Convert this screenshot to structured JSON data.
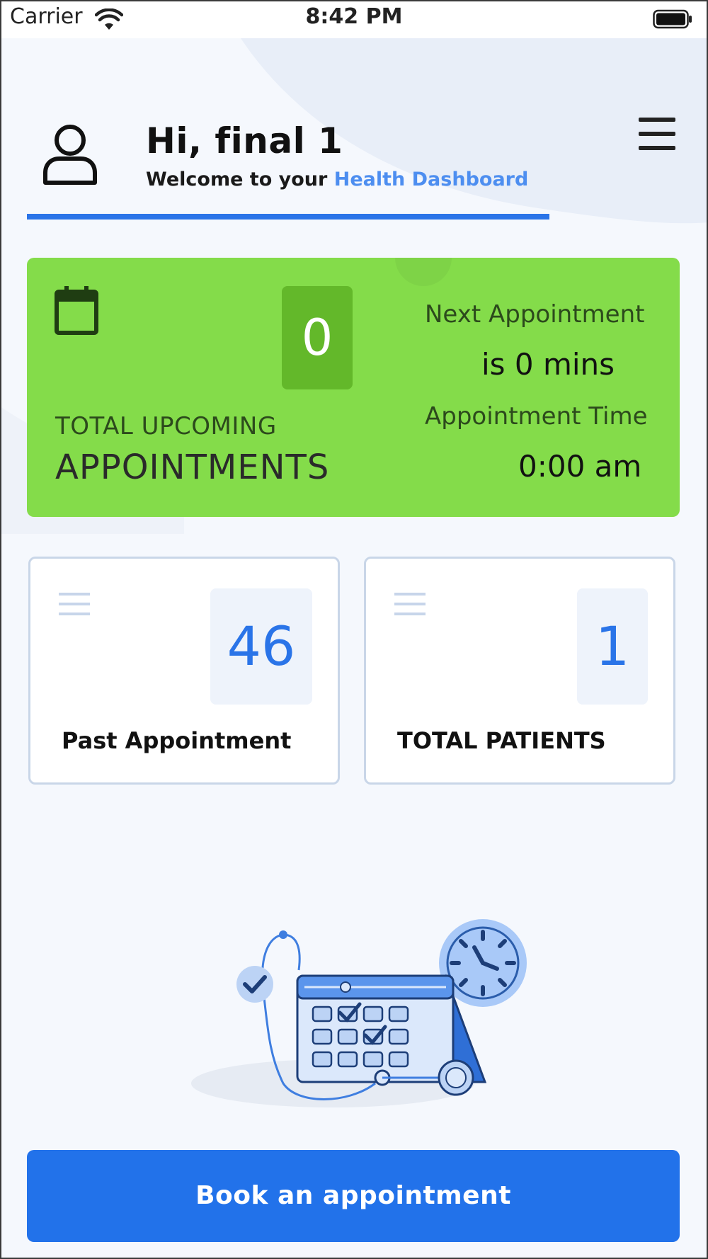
{
  "status_bar": {
    "carrier": "Carrier",
    "time": "8:42 PM"
  },
  "header": {
    "greeting": "Hi, final 1",
    "welcome_prefix": "Welcome to your ",
    "welcome_highlight": "Health Dashboard",
    "icons": {
      "avatar": "user-icon",
      "menu": "hamburger-menu-icon"
    }
  },
  "upcoming": {
    "count": "0",
    "subtitle": "TOTAL UPCOMING",
    "title": "APPOINTMENTS",
    "next_label": "Next Appointment",
    "next_value": "is 0 mins",
    "time_label": "Appointment Time",
    "time_value": "0:00 am",
    "icon": "calendar-icon"
  },
  "stats": [
    {
      "value": "46",
      "label": "Past Appointment",
      "icon": "list-lines-icon"
    },
    {
      "value": "1",
      "label": "TOTAL PATIENTS",
      "icon": "list-lines-icon"
    }
  ],
  "illustration": "calendar-stethoscope-clock-illustration",
  "actions": {
    "book_label": "Book an appointment"
  },
  "colors": {
    "accent_blue": "#2272ea",
    "highlight_blue": "#4d8ef0",
    "card_green": "#84dc4a",
    "count_green": "#63b82a",
    "background": "#f5f8fd"
  }
}
